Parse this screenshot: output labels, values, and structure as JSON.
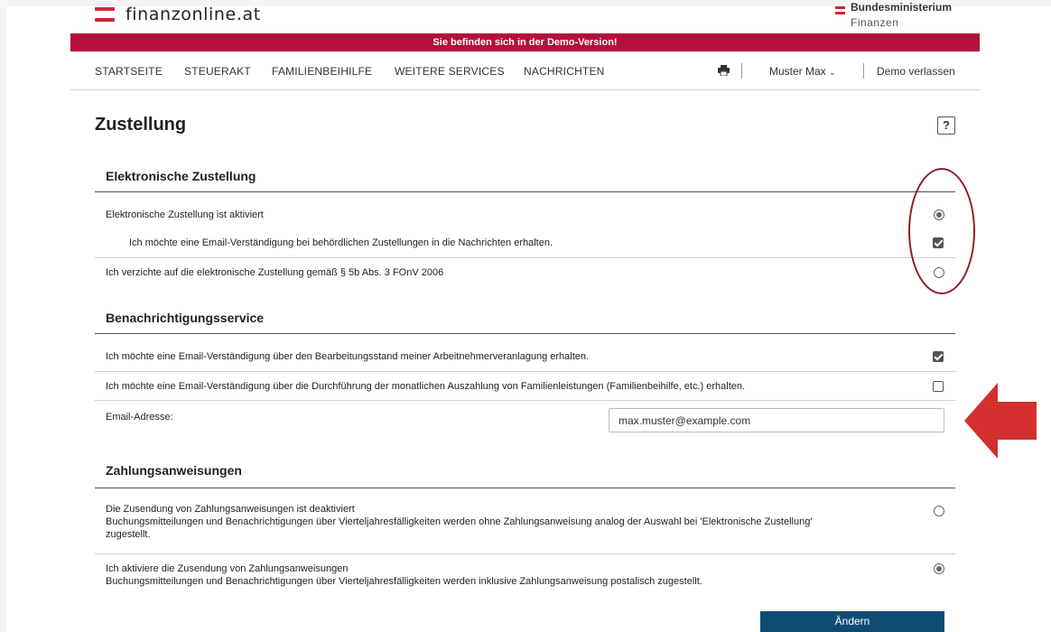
{
  "header": {
    "logo_text": "finanzonline.at",
    "ministry_name": "Bundesministerium",
    "ministry_sub": "Finanzen",
    "accent_color": "#d9213a"
  },
  "demo_banner": "Sie befinden sich in der Demo-Version!",
  "nav": {
    "items": [
      "STARTSEITE",
      "STEUERAKT",
      "FAMILIENBEIHILFE",
      "WEITERE SERVICES",
      "NACHRICHTEN"
    ],
    "print_icon": "printer-icon",
    "user": "Muster Max",
    "logout": "Demo verlassen"
  },
  "page": {
    "title": "Zustellung",
    "help_label": "?"
  },
  "sections": {
    "elektronisch": {
      "title": "Elektronische Zustellung",
      "option_active": "Elektronische Zustellung ist aktiviert",
      "option_email_notice": "Ich möchte eine Email-Verständigung bei behördlichen Zustellungen in die Nachrichten erhalten.",
      "option_waive": "Ich verzichte auf die elektronische Zustellung gemäß § 5b Abs. 3 FOnV 2006",
      "active_selected": true,
      "email_notice_checked": true,
      "waive_selected": false
    },
    "benachrichtigung": {
      "title": "Benachrichtigungsservice",
      "option_anv": "Ich möchte eine Email-Verständigung über den Bearbeitungsstand meiner Arbeitnehmerveranlagung erhalten.",
      "option_family": "Ich möchte eine Email-Verständigung über die Durchführung der monatlichen Auszahlung von Familienleistungen (Familienbeihilfe, etc.) erhalten.",
      "anv_checked": true,
      "family_checked": false,
      "email_label": "Email-Adresse:",
      "email_value": "max.muster@example.com"
    },
    "zahlung": {
      "title": "Zahlungsanweisungen",
      "option_off_line1": "Die Zusendung von Zahlungsanweisungen ist deaktiviert",
      "option_off_line2": "Buchungsmitteilungen und Benachrichtigungen über Vierteljahresfälligkeiten werden ohne Zahlungsanweisung analog der Auswahl bei 'Elektronische Zustellung' zugestellt.",
      "option_on_line1": "Ich aktiviere die Zusendung von Zahlungsanweisungen",
      "option_on_line2": "Buchungsmitteilungen und Benachrichtigungen über Vierteljahresfälligkeiten werden inklusive Zahlungsanweisung postalisch zugestellt.",
      "off_selected": false,
      "on_selected": true
    }
  },
  "submit_label": "Ändern",
  "annotation_color": "#8e1c2a",
  "arrow_color": "#d32f2f"
}
